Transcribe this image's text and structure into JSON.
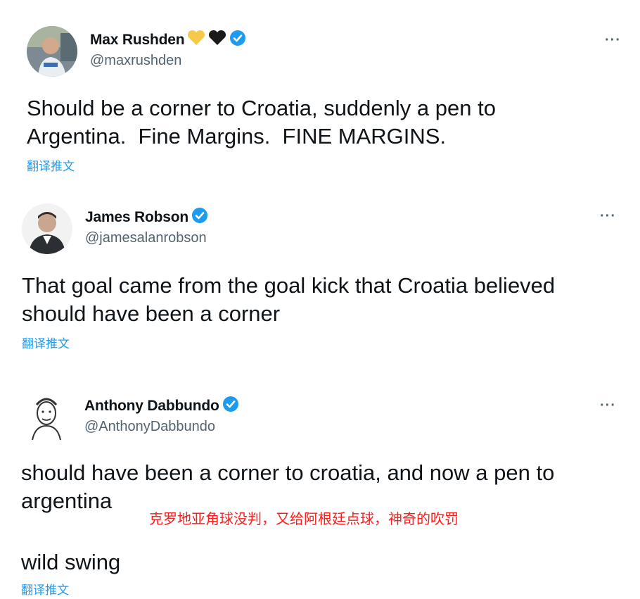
{
  "tweets": [
    {
      "name": "Max Rushden",
      "emojis": [
        "yellow-heart",
        "black-heart"
      ],
      "handle": "@maxrushden",
      "text": "Should be a corner to Croatia, suddenly a pen to\nArgentina.  Fine Margins.  FINE MARGINS.",
      "translate_label": "翻译推文",
      "more_label": "···"
    },
    {
      "name": "James Robson",
      "handle": "@jamesalanrobson",
      "text": "That goal came from the goal kick that Croatia believed\nshould have been a corner",
      "translate_label": "翻译推文",
      "more_label": "···"
    },
    {
      "name": "Anthony Dabbundo",
      "handle": "@AnthonyDabbundo",
      "text": "should have been a corner to croatia, and now a pen to\nargentina",
      "text2": "wild swing",
      "translate_label": "翻译推文",
      "more_label": "···"
    }
  ],
  "overlay_caption": "克罗地亚角球没判，又给阿根廷点球，神奇的吹罚",
  "colors": {
    "verified": "#1d9bf0",
    "link": "#1d9bf0",
    "handle": "#536471",
    "overlay": "#ff1b1b",
    "yellow_heart": "#f7c948",
    "black_heart": "#1a1a1a"
  }
}
